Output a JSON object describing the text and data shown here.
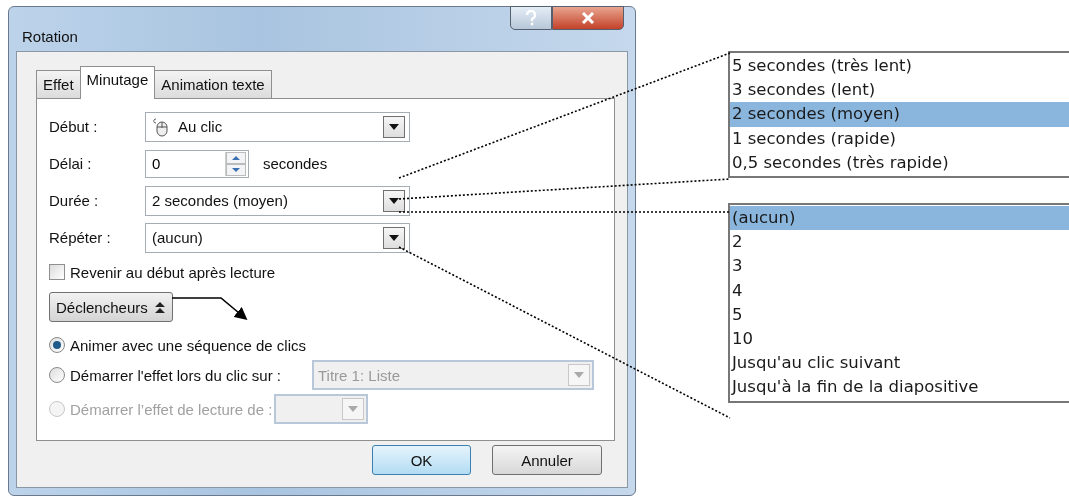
{
  "window": {
    "title": "Rotation"
  },
  "tabs": [
    {
      "label": "Effet",
      "selected": false
    },
    {
      "label": "Minutage",
      "selected": true
    },
    {
      "label": "Animation texte",
      "selected": false
    }
  ],
  "fields": [
    {
      "kind": "clickdropdown",
      "label": "Début :",
      "value": "Au clic"
    },
    {
      "kind": "spinner",
      "label": "Délai :",
      "value": "0",
      "unit": "secondes"
    },
    {
      "kind": "dropdown",
      "label": "Durée :",
      "value": "2 secondes (moyen)"
    },
    {
      "kind": "dropdown",
      "label": "Répéter :",
      "value": "(aucun)"
    }
  ],
  "loop_checkbox": {
    "label": "Revenir au début après lecture",
    "checked": false
  },
  "triggers_button": {
    "label": "Déclencheurs",
    "expanded": true
  },
  "trigger_options": [
    {
      "label": "Animer avec une séquence de clics",
      "selected": true,
      "disabled": false
    },
    {
      "label": "Démarrer l'effet lors du clic sur :",
      "selected": false,
      "disabled": false,
      "dropdown": {
        "value": "Titre 1: Liste",
        "disabled": true
      }
    },
    {
      "label": "Démarrer l’effet de lecture de :",
      "selected": false,
      "disabled": true,
      "dropdown": {
        "disabled": true
      }
    }
  ],
  "buttons": [
    {
      "label": "OK",
      "default": true
    },
    {
      "label": "Annuler",
      "default": false
    }
  ],
  "duration_list": [
    {
      "label": "5 secondes (très lent)",
      "selected": false
    },
    {
      "label": "3 secondes (lent)",
      "selected": false
    },
    {
      "label": "2 secondes (moyen)",
      "selected": true
    },
    {
      "label": "1 secondes (rapide)",
      "selected": false
    },
    {
      "label": "0,5 secondes (très rapide)",
      "selected": false
    }
  ],
  "repeat_list": [
    {
      "label": "(aucun)",
      "selected": true
    },
    {
      "label": "2",
      "selected": false
    },
    {
      "label": "3",
      "selected": false
    },
    {
      "label": "4",
      "selected": false
    },
    {
      "label": "5",
      "selected": false
    },
    {
      "label": "10",
      "selected": false
    },
    {
      "label": "Jusqu'au clic suivant",
      "selected": false
    },
    {
      "label": "Jusqu'à la fin de la diapositive",
      "selected": false
    }
  ]
}
